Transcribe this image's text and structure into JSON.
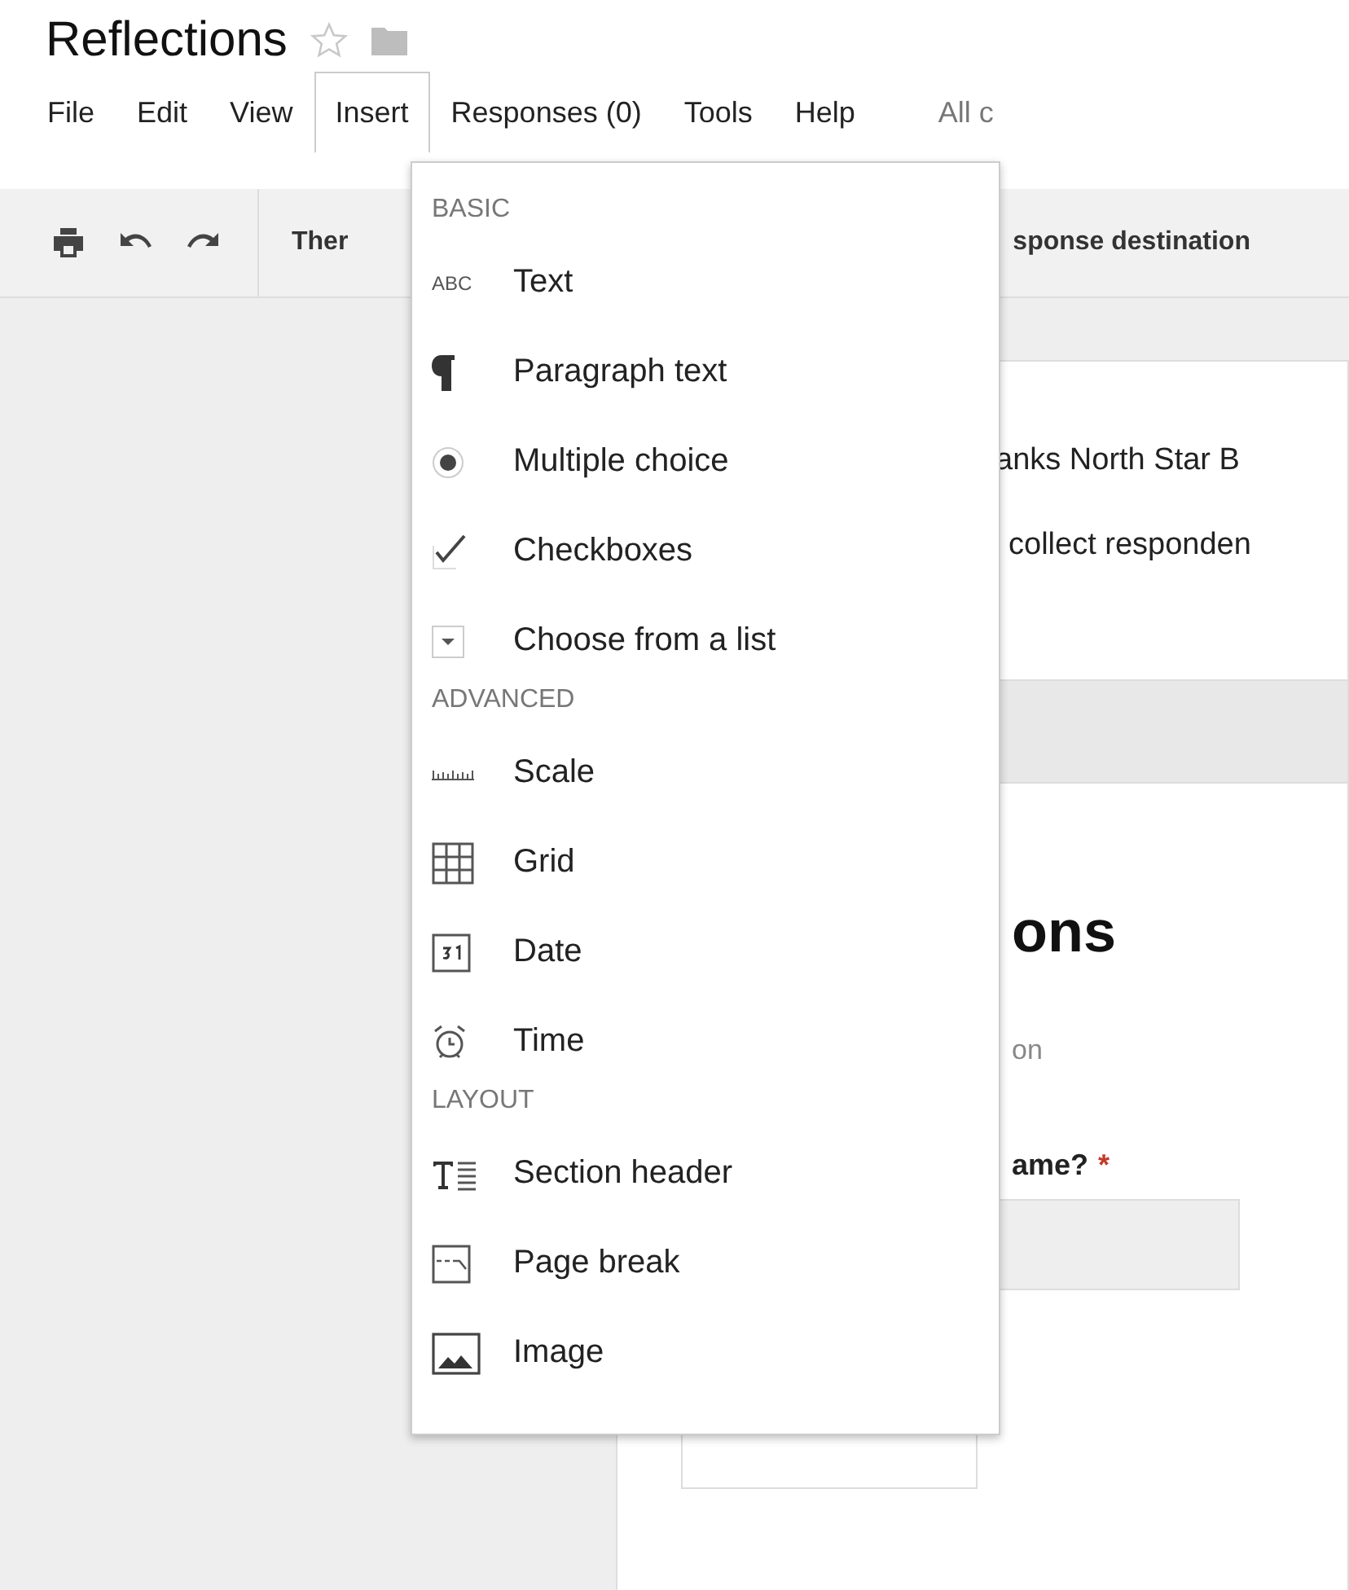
{
  "document": {
    "title": "Reflections",
    "starred": false
  },
  "menu_bar": [
    {
      "label": "File",
      "selected": false
    },
    {
      "label": "Edit",
      "selected": false
    },
    {
      "label": "View",
      "selected": false
    },
    {
      "label": "Insert",
      "selected": true
    },
    {
      "label": "Responses (0)",
      "selected": false
    },
    {
      "label": "Tools",
      "selected": false
    },
    {
      "label": "Help",
      "selected": false
    }
  ],
  "save_status": "All c",
  "toolbar": {
    "theme_button": "Ther",
    "destination_button": "sponse destination"
  },
  "form": {
    "header_line_1": "anks North Star B",
    "header_line_2": "collect responden",
    "title": "ons",
    "description": "on",
    "question": "ame?",
    "required_mark": "*"
  },
  "insert_menu": [
    {
      "heading": "BASIC",
      "items": [
        {
          "kind": "text",
          "icon_text": "ABC",
          "label": "Text"
        },
        {
          "kind": "paragraph",
          "label": "Paragraph text"
        },
        {
          "kind": "radio",
          "label": "Multiple choice"
        },
        {
          "kind": "checkbox",
          "label": "Checkboxes"
        },
        {
          "kind": "list",
          "label": "Choose from a list"
        }
      ]
    },
    {
      "heading": "ADVANCED",
      "items": [
        {
          "kind": "scale",
          "label": "Scale"
        },
        {
          "kind": "grid",
          "label": "Grid"
        },
        {
          "kind": "date",
          "label": "Date"
        },
        {
          "kind": "time",
          "label": "Time"
        }
      ]
    },
    {
      "heading": "LAYOUT",
      "items": [
        {
          "kind": "section",
          "label": "Section header"
        },
        {
          "kind": "pagebreak",
          "label": "Page break"
        },
        {
          "kind": "image",
          "label": "Image"
        }
      ]
    }
  ]
}
